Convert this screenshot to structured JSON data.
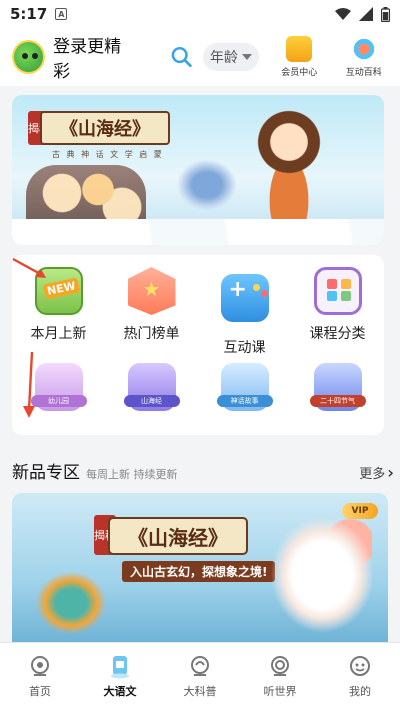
{
  "status_bar": {
    "time": "5:17",
    "app_glyph": "A"
  },
  "header": {
    "login_text": "登录更精彩",
    "age_label": "年龄",
    "vip_label": "会员中心",
    "encyclopedia_label": "互动百科"
  },
  "banner": {
    "seal_text": "揭秘",
    "title": "《山海经》",
    "subtitle": "古 典 神 话 文 学 启 蒙"
  },
  "categories": {
    "row1": [
      {
        "label": "本月上新",
        "icon": "new-icon"
      },
      {
        "label": "热门榜单",
        "icon": "star-badge-icon"
      },
      {
        "label": "互动课",
        "icon": "gamepad-icon"
      },
      {
        "label": "课程分类",
        "icon": "category-board-icon"
      }
    ],
    "row2": [
      {
        "tag": "幼儿园",
        "icon": "kindergarten-icon"
      },
      {
        "tag": "山海经",
        "icon": "shanhaijing-icon"
      },
      {
        "tag": "神话故事",
        "icon": "myth-story-icon"
      },
      {
        "tag": "二十四节气",
        "icon": "solar-terms-icon"
      }
    ]
  },
  "new_section": {
    "title": "新品专区",
    "subtitle": "每周上新 持续更新",
    "more": "更多"
  },
  "promo": {
    "vip_badge": "VIP",
    "seal_text": "揭秘",
    "title": "《山海经》",
    "slogan": "入山古玄幻，探想象之境!"
  },
  "tabs": [
    {
      "label": "首页",
      "icon": "home-icon",
      "active": false
    },
    {
      "label": "大语文",
      "icon": "chinese-book-icon",
      "active": true
    },
    {
      "label": "大科普",
      "icon": "science-icon",
      "active": false
    },
    {
      "label": "听世界",
      "icon": "listen-icon",
      "active": false
    },
    {
      "label": "我的",
      "icon": "profile-icon",
      "active": false
    }
  ],
  "colors": {
    "accent": "#e8472f",
    "background": "#f3f4f6",
    "search": "#3aa3e6"
  }
}
